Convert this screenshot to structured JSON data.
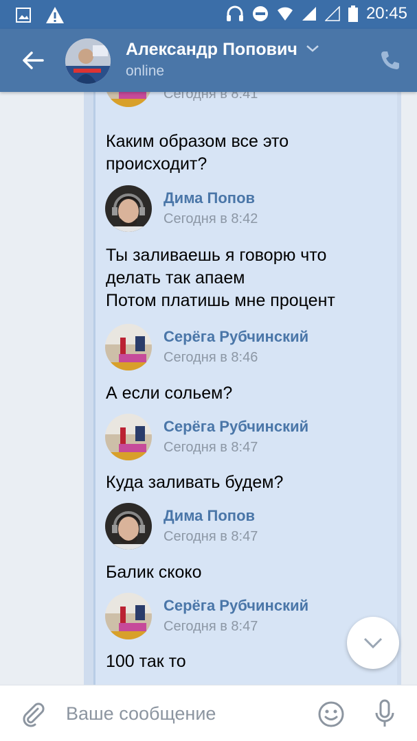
{
  "status_bar": {
    "time": "20:45"
  },
  "header": {
    "name": "Александр Попович",
    "status": "online"
  },
  "messages": [
    {
      "name": "",
      "date": "Сегодня в 8:41",
      "text": "Каким образом все это\nпроисходит?",
      "avatar": "sergey"
    },
    {
      "name": "Дима Попов",
      "date": "Сегодня в 8:42",
      "text": "Ты заливаешь я говорю  что\nделать  так апаем\nПотом платишь мне процент",
      "avatar": "dima"
    },
    {
      "name": "Серёга Рубчинский",
      "date": "Сегодня в 8:46",
      "text": "А если сольем?",
      "avatar": "sergey"
    },
    {
      "name": "Серёга Рубчинский",
      "date": "Сегодня в 8:47",
      "text": "Куда заливать будем?",
      "avatar": "sergey"
    },
    {
      "name": "Дима Попов",
      "date": "Сегодня в 8:47",
      "text": "Балик скоко",
      "avatar": "dima"
    },
    {
      "name": "Серёга Рубчинский",
      "date": "Сегодня в 8:47",
      "text": "100 так то",
      "avatar": "sergey"
    }
  ],
  "composer": {
    "placeholder": "Ваше сообщение"
  },
  "colors": {
    "header": "#4a76a8",
    "bubble": "#d7e4f5",
    "name": "#4a76a8"
  }
}
